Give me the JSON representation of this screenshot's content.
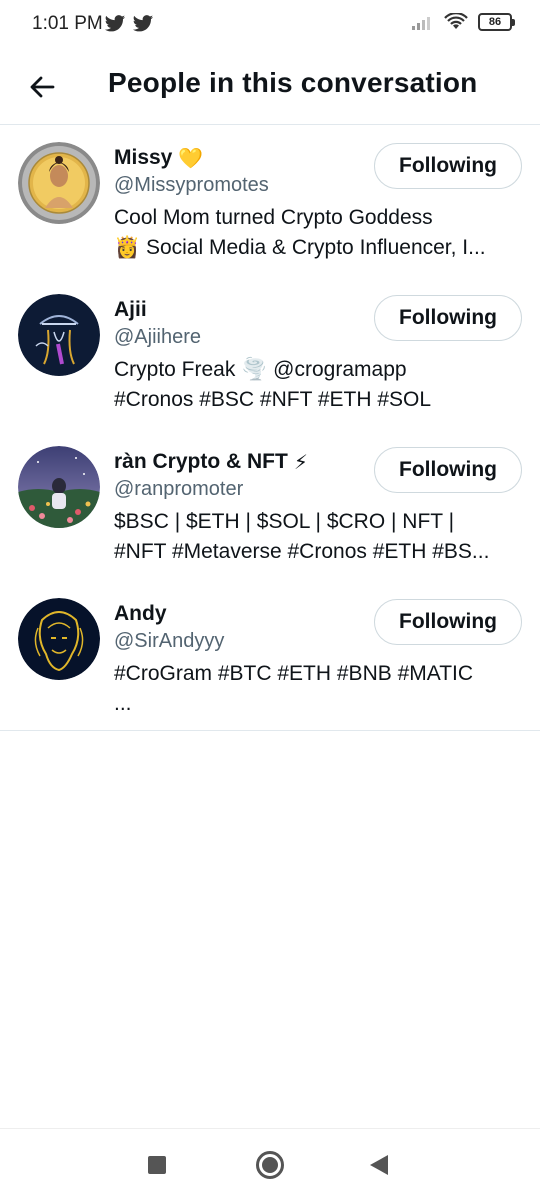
{
  "status_bar": {
    "time": "1:01 PM",
    "battery": "86",
    "icons": [
      "twitter-icon",
      "twitter-icon",
      "signal-icon",
      "wifi-icon",
      "battery-icon"
    ]
  },
  "header": {
    "title": "People in this conversation",
    "back_icon": "arrow-left-icon"
  },
  "people": [
    {
      "name": "Missy",
      "emoji": "💛",
      "handle": "@Missypromotes",
      "bio_lines": [
        "Cool Mom turned Crypto Goddess",
        "👸 Social Media & Crypto Influencer, I..."
      ],
      "button": "Following"
    },
    {
      "name": "Ajii",
      "emoji": "",
      "handle": "@Ajiihere",
      "bio_lines": [
        "Crypto Freak  🌪️ @crogramapp",
        "#Cronos #BSC #NFT #ETH #SOL"
      ],
      "button": "Following"
    },
    {
      "name": "ràn Crypto & NFT",
      "emoji": "⚡",
      "handle": "@ranpromoter",
      "bio_lines": [
        "$BSC | $ETH | $SOL | $CRO | NFT |",
        "#NFT #Metaverse #Cronos #ETH #BS..."
      ],
      "button": "Following"
    },
    {
      "name": "Andy",
      "emoji": "",
      "handle": "@SirAndyyy",
      "bio_lines": [
        "#CroGram #BTC #ETH #BNB #MATIC",
        "..."
      ],
      "button": "Following"
    }
  ],
  "nav_bar": {
    "icons": [
      "recents-square-icon",
      "home-circle-icon",
      "back-triangle-icon"
    ]
  },
  "colors": {
    "text_primary": "#0f1419",
    "text_secondary": "#536471",
    "border": "#cfd9de",
    "divider": "#e1e8ed"
  }
}
